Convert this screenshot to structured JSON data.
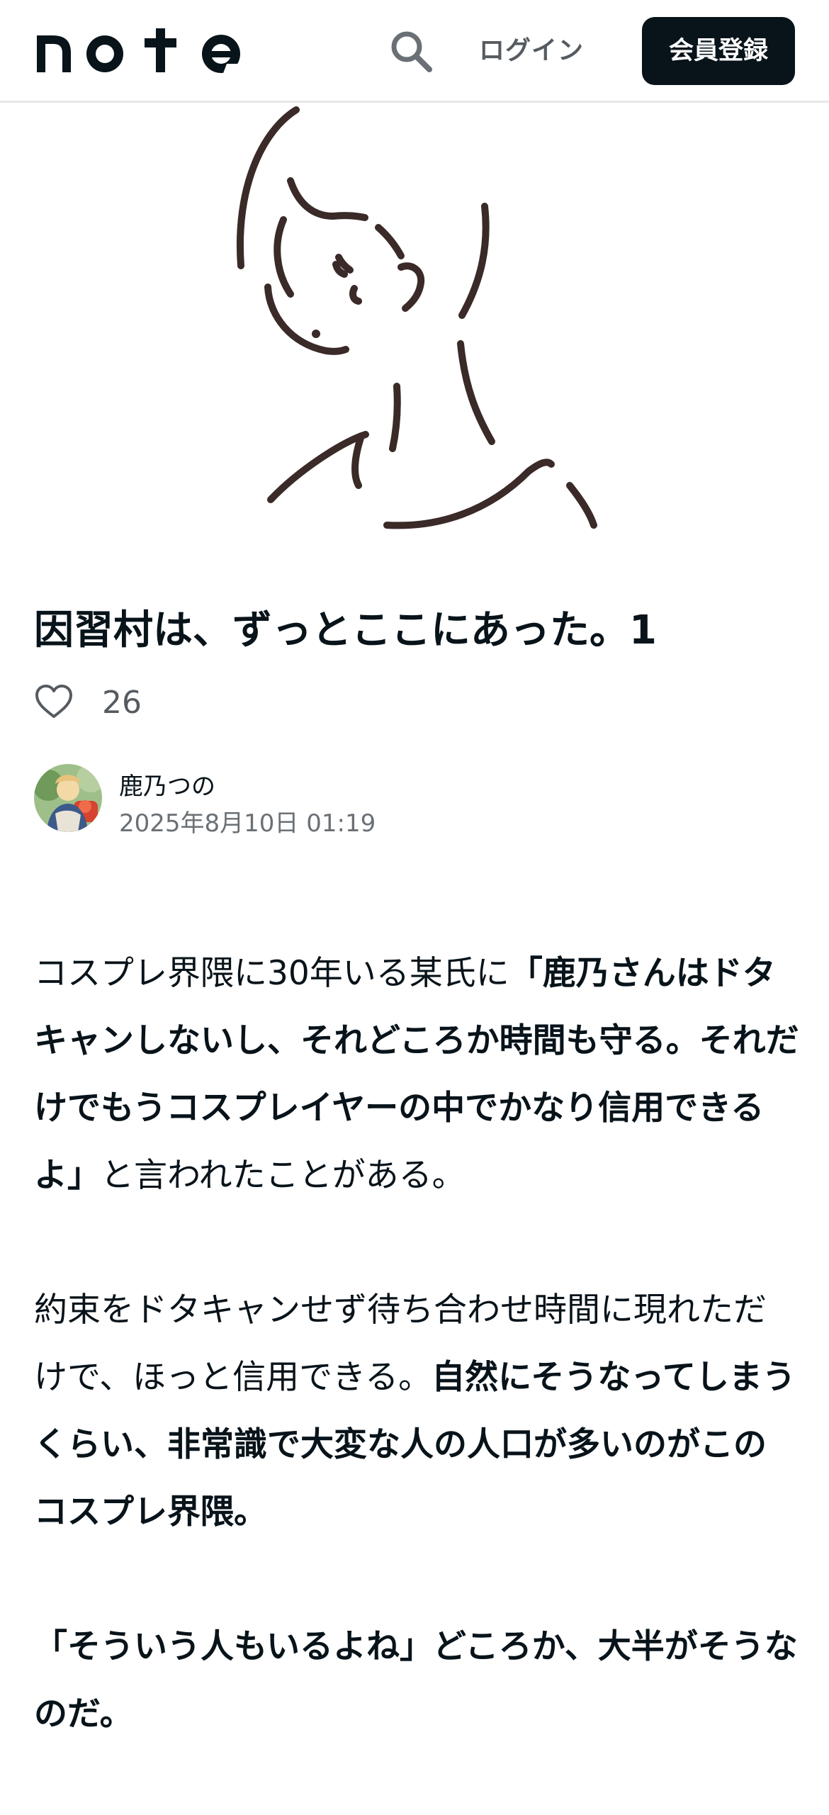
{
  "header": {
    "logo_text": "note",
    "search_icon": "search-icon",
    "login_label": "ログイン",
    "signup_label": "会員登録",
    "brand_color": "#08131a"
  },
  "article": {
    "title": "因習村は、ずっとここにあった。1",
    "like_icon": "heart-outline-icon",
    "like_count": "26",
    "author_name": "鹿乃つの",
    "published": "2025年8月10日 01:19",
    "paragraphs": [
      [
        {
          "text": "コスプレ界隈に30年いる某氏に",
          "bold": false
        },
        {
          "text": "「鹿乃さんはドタキャンしないし、それどころか時間も守る。それだけでもうコスプレイヤーの中でかなり信用できるよ」",
          "bold": true
        },
        {
          "text": "と言われたことがある。",
          "bold": false
        }
      ],
      [
        {
          "text": "約束をドタキャンせず待ち合わせ時間に現れただけで、ほっと信用できる。",
          "bold": false
        },
        {
          "text": "自然にそうなってしまうくらい、非常識で大変な人の人口が多いのがこのコスプレ界隈。",
          "bold": true
        }
      ],
      [
        {
          "text": "「そういう人もいるよね」どころか、大半がそうなのだ。",
          "bold": true
        }
      ]
    ]
  }
}
